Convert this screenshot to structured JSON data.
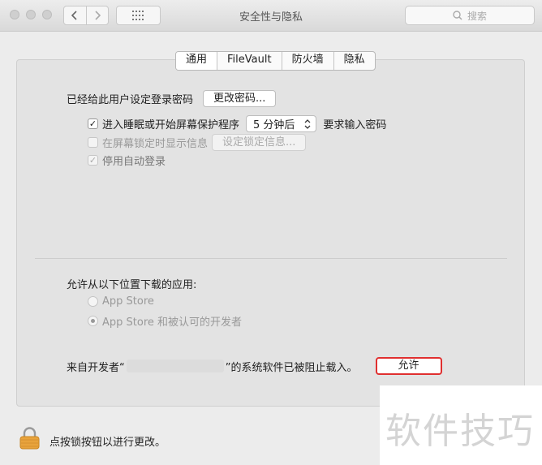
{
  "window": {
    "title": "安全性与隐私"
  },
  "toolbar": {
    "search_placeholder": "搜索"
  },
  "tabs": [
    {
      "label": "通用",
      "active": true
    },
    {
      "label": "FileVault",
      "active": false
    },
    {
      "label": "防火墙",
      "active": false
    },
    {
      "label": "隐私",
      "active": false
    }
  ],
  "general": {
    "password_label": "已经给此用户设定登录密码",
    "change_password_button": "更改密码...",
    "require_password": {
      "checked": true,
      "label": "进入睡眠或开始屏幕保护程序",
      "select_value": "5 分钟后",
      "suffix": "要求输入密码"
    },
    "show_message": {
      "checked": false,
      "label": "在屏幕锁定时显示信息",
      "button": "设定锁定信息..."
    },
    "disable_autologin": {
      "checked": true,
      "label": "停用自动登录"
    }
  },
  "downloads": {
    "heading": "允许从以下位置下载的应用:",
    "options": [
      {
        "label": "App Store",
        "selected": false
      },
      {
        "label": "App Store 和被认可的开发者",
        "selected": true
      }
    ]
  },
  "blocked": {
    "prefix": "来自开发者“",
    "suffix": "”的系统软件已被阻止载入。",
    "allow_button": "允许"
  },
  "footer": {
    "lock_text": "点按锁按钮以进行更改。"
  },
  "watermark": "软件技巧",
  "colors": {
    "highlight": "#e03030",
    "lock": "#e8a33c"
  }
}
